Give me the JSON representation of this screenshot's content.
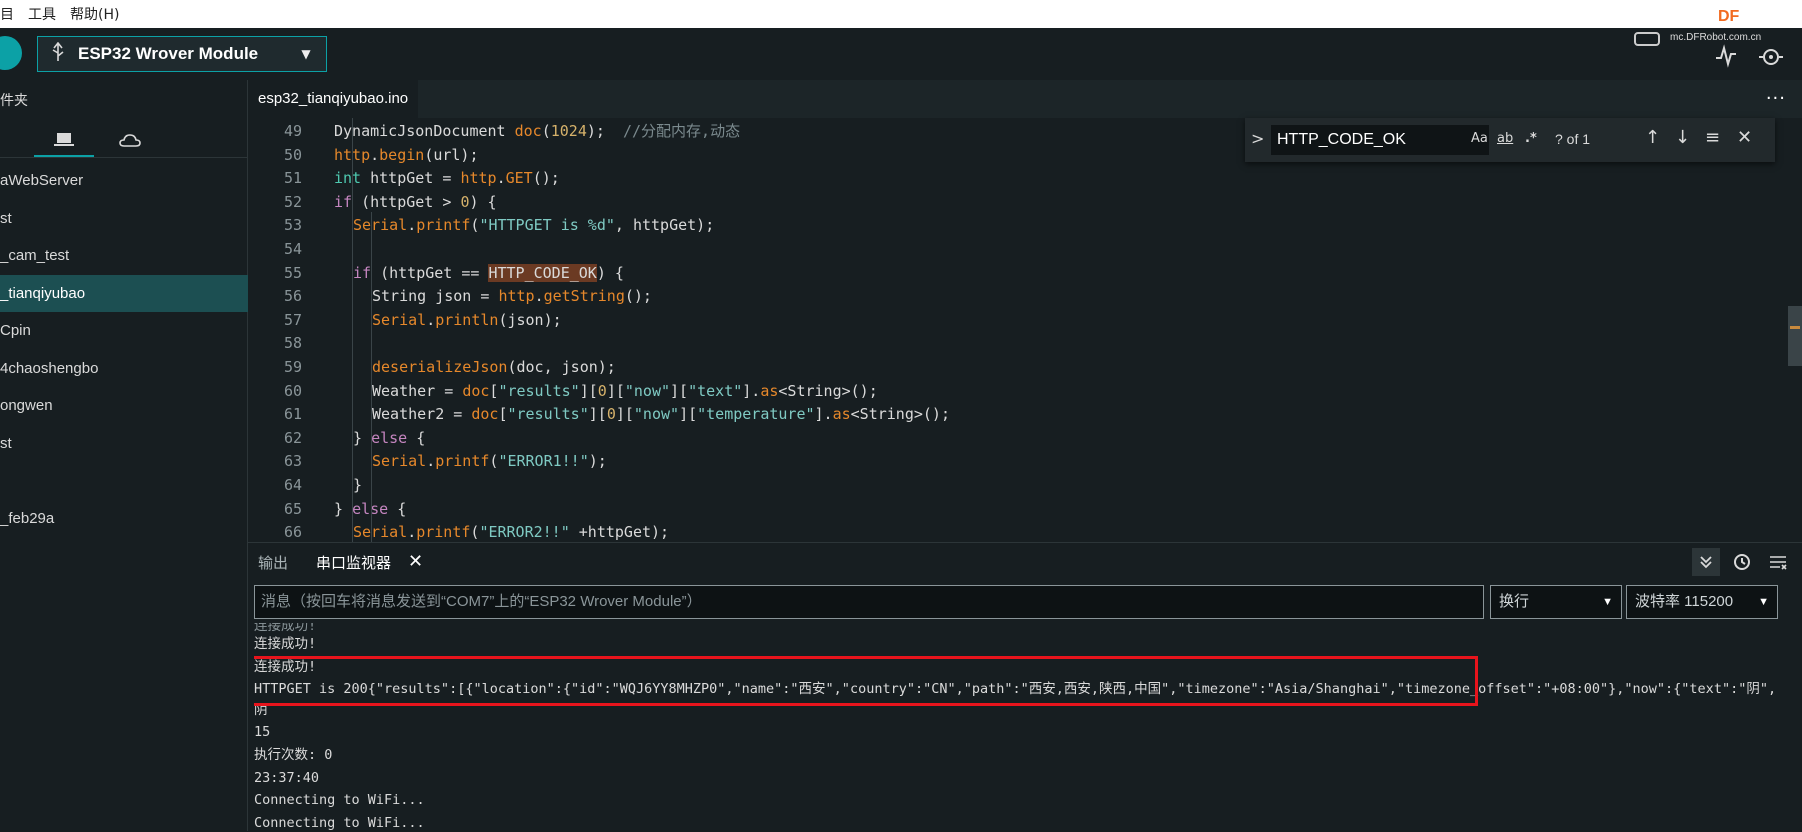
{
  "menu": [
    "目",
    "工具",
    "帮助(H)"
  ],
  "watermark": {
    "brand": "DF",
    "url": "mc.DFRobot.com.cn"
  },
  "toolbar": {
    "board": "ESP32 Wrover Module"
  },
  "sidebar": {
    "title": "件夹",
    "items": [
      "aWebServer",
      "st",
      "_cam_test",
      "_tianqiyubao",
      "Cpin",
      "4chaoshengbo",
      "ongwen",
      "st",
      "",
      "_feb29a"
    ],
    "active_index": 3
  },
  "editor": {
    "file_tab": "esp32_tianqiyubao.ino",
    "more": "···",
    "lines": [
      {
        "n": "49",
        "parts": [
          {
            "t": "DynamicJsonDocument ",
            "c": ""
          },
          {
            "t": "doc",
            "c": "fn"
          },
          {
            "t": "(",
            "c": ""
          },
          {
            "t": "1024",
            "c": "nu"
          },
          {
            "t": ");  ",
            "c": ""
          },
          {
            "t": "//分配内存,动态",
            "c": "cm"
          }
        ],
        "indent": 1
      },
      {
        "n": "50",
        "parts": [
          {
            "t": "http",
            "c": "fn"
          },
          {
            "t": ".",
            "c": ""
          },
          {
            "t": "begin",
            "c": "fn"
          },
          {
            "t": "(url);",
            "c": ""
          }
        ],
        "indent": 1
      },
      {
        "n": "51",
        "parts": [
          {
            "t": "int",
            "c": "ty"
          },
          {
            "t": " httpGet = ",
            "c": ""
          },
          {
            "t": "http",
            "c": "fn"
          },
          {
            "t": ".",
            "c": ""
          },
          {
            "t": "GET",
            "c": "fn"
          },
          {
            "t": "();",
            "c": ""
          }
        ],
        "indent": 1
      },
      {
        "n": "52",
        "parts": [
          {
            "t": "if",
            "c": "kw"
          },
          {
            "t": " (httpGet > ",
            "c": ""
          },
          {
            "t": "0",
            "c": "nu"
          },
          {
            "t": ") {",
            "c": ""
          }
        ],
        "indent": 1
      },
      {
        "n": "53",
        "parts": [
          {
            "t": "Serial",
            "c": "fn"
          },
          {
            "t": ".",
            "c": ""
          },
          {
            "t": "printf",
            "c": "fn"
          },
          {
            "t": "(",
            "c": ""
          },
          {
            "t": "\"HTTPGET is %d\"",
            "c": "st"
          },
          {
            "t": ", httpGet);",
            "c": ""
          }
        ],
        "indent": 2
      },
      {
        "n": "54",
        "parts": [],
        "indent": 2
      },
      {
        "n": "55",
        "parts": [
          {
            "t": "if",
            "c": "kw"
          },
          {
            "t": " (httpGet == ",
            "c": ""
          },
          {
            "t": "HTTP_CODE_OK",
            "c": "hl"
          },
          {
            "t": ") {",
            "c": ""
          }
        ],
        "indent": 2
      },
      {
        "n": "56",
        "parts": [
          {
            "t": "String json = ",
            "c": ""
          },
          {
            "t": "http",
            "c": "fn"
          },
          {
            "t": ".",
            "c": ""
          },
          {
            "t": "getString",
            "c": "fn"
          },
          {
            "t": "();",
            "c": ""
          }
        ],
        "indent": 3
      },
      {
        "n": "57",
        "parts": [
          {
            "t": "Serial",
            "c": "fn"
          },
          {
            "t": ".",
            "c": ""
          },
          {
            "t": "println",
            "c": "fn"
          },
          {
            "t": "(json);",
            "c": ""
          }
        ],
        "indent": 3
      },
      {
        "n": "58",
        "parts": [],
        "indent": 3
      },
      {
        "n": "59",
        "parts": [
          {
            "t": "deserializeJson",
            "c": "fn"
          },
          {
            "t": "(doc, json);",
            "c": ""
          }
        ],
        "indent": 3
      },
      {
        "n": "60",
        "parts": [
          {
            "t": "Weather = ",
            "c": ""
          },
          {
            "t": "doc",
            "c": "fn"
          },
          {
            "t": "[",
            "c": ""
          },
          {
            "t": "\"results\"",
            "c": "st"
          },
          {
            "t": "][",
            "c": ""
          },
          {
            "t": "0",
            "c": "nu"
          },
          {
            "t": "][",
            "c": ""
          },
          {
            "t": "\"now\"",
            "c": "st"
          },
          {
            "t": "][",
            "c": ""
          },
          {
            "t": "\"text\"",
            "c": "st"
          },
          {
            "t": "].",
            "c": ""
          },
          {
            "t": "as",
            "c": "fn"
          },
          {
            "t": "<String>();",
            "c": ""
          }
        ],
        "indent": 3
      },
      {
        "n": "61",
        "parts": [
          {
            "t": "Weather2 = ",
            "c": ""
          },
          {
            "t": "doc",
            "c": "fn"
          },
          {
            "t": "[",
            "c": ""
          },
          {
            "t": "\"results\"",
            "c": "st"
          },
          {
            "t": "][",
            "c": ""
          },
          {
            "t": "0",
            "c": "nu"
          },
          {
            "t": "][",
            "c": ""
          },
          {
            "t": "\"now\"",
            "c": "st"
          },
          {
            "t": "][",
            "c": ""
          },
          {
            "t": "\"temperature\"",
            "c": "st"
          },
          {
            "t": "].",
            "c": ""
          },
          {
            "t": "as",
            "c": "fn"
          },
          {
            "t": "<String>();",
            "c": ""
          }
        ],
        "indent": 3
      },
      {
        "n": "62",
        "parts": [
          {
            "t": "} ",
            "c": ""
          },
          {
            "t": "else",
            "c": "kw"
          },
          {
            "t": " {",
            "c": ""
          }
        ],
        "indent": 2
      },
      {
        "n": "63",
        "parts": [
          {
            "t": "Serial",
            "c": "fn"
          },
          {
            "t": ".",
            "c": ""
          },
          {
            "t": "printf",
            "c": "fn"
          },
          {
            "t": "(",
            "c": ""
          },
          {
            "t": "\"ERROR1!!\"",
            "c": "st"
          },
          {
            "t": ");",
            "c": ""
          }
        ],
        "indent": 3
      },
      {
        "n": "64",
        "parts": [
          {
            "t": "}",
            "c": ""
          }
        ],
        "indent": 2
      },
      {
        "n": "65",
        "parts": [
          {
            "t": "} ",
            "c": ""
          },
          {
            "t": "else",
            "c": "kw"
          },
          {
            "t": " {",
            "c": ""
          }
        ],
        "indent": 1
      },
      {
        "n": "66",
        "parts": [
          {
            "t": "Serial",
            "c": "fn"
          },
          {
            "t": ".",
            "c": ""
          },
          {
            "t": "printf",
            "c": "fn"
          },
          {
            "t": "(",
            "c": ""
          },
          {
            "t": "\"ERROR2!!\"",
            "c": "st"
          },
          {
            "t": " +httpGet);",
            "c": ""
          }
        ],
        "indent": 2
      }
    ]
  },
  "find": {
    "query": "HTTP_CODE_OK",
    "match_case": "Aa",
    "whole_word": "ab",
    "regex": ".*",
    "count": "? of 1",
    "chevron": ">",
    "prev": "↑",
    "next": "↓",
    "selection": "≡",
    "close": "✕"
  },
  "panel": {
    "tab_output": "输出",
    "tab_serial": "串口监视器",
    "close": "✕",
    "message_placeholder": "消息（按回车将消息发送到“COM7”上的“ESP32 Wrover Module”）",
    "line_ending": "换行",
    "baud": "波特率 115200",
    "output_lines": [
      "连接成功!",
      "连接成功!",
      "HTTPGET is 200{\"results\":[{\"location\":{\"id\":\"WQJ6YY8MHZP0\",\"name\":\"西安\",\"country\":\"CN\",\"path\":\"西安,西安,陕西,中国\",\"timezone\":\"Asia/Shanghai\",\"timezone_offset\":\"+08:00\"},\"now\":{\"text\":\"阴\",",
      "阴",
      "15",
      "执行次数: 0",
      "23:37:40",
      "Connecting to WiFi...",
      "Connecting to WiFi..."
    ]
  }
}
